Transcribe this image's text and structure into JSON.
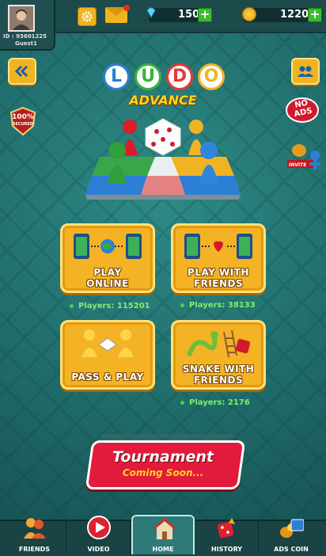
{
  "header": {
    "user_id": "ID : 93601225",
    "user_name": "Guest1",
    "gems": "150",
    "coins": "1220",
    "plus": "+"
  },
  "logo": {
    "letters": [
      "L",
      "U",
      "D",
      "O"
    ],
    "letter_colors": [
      "#2d7fd6",
      "#38b43a",
      "#e23a3a",
      "#f0b324"
    ],
    "subtitle": "ADVANCE"
  },
  "badges": {
    "secured": "100%",
    "secured_sub": "SECURED",
    "no_ads_1": "NO",
    "no_ads_2": "ADS",
    "invite": "INVITE"
  },
  "menu": {
    "play_online": {
      "line1": "PLAY",
      "line2": "ONLINE",
      "players": "Players: 115201"
    },
    "play_friends": {
      "line1": "PLAY WITH",
      "line2": "FRIENDS",
      "players": "Players: 38133"
    },
    "pass_play": {
      "line1": "PASS & PLAY"
    },
    "snake_friends": {
      "line1": "SNAKE WITH",
      "line2": "FRIENDS",
      "players": "Players: 2176"
    }
  },
  "tournament": {
    "title": "Tournament",
    "subtitle": "Coming Soon..."
  },
  "nav": {
    "friends": "FRIENDS",
    "video": "VIDEO",
    "home": "HOME",
    "history": "HISTORY",
    "ads_coin": "ADS COIN"
  },
  "colors": {
    "accent_gold": "#f4b325",
    "tournament_red": "#e21b3c",
    "players_green": "#7ef06b",
    "background_teal": "#1f6b6a"
  }
}
